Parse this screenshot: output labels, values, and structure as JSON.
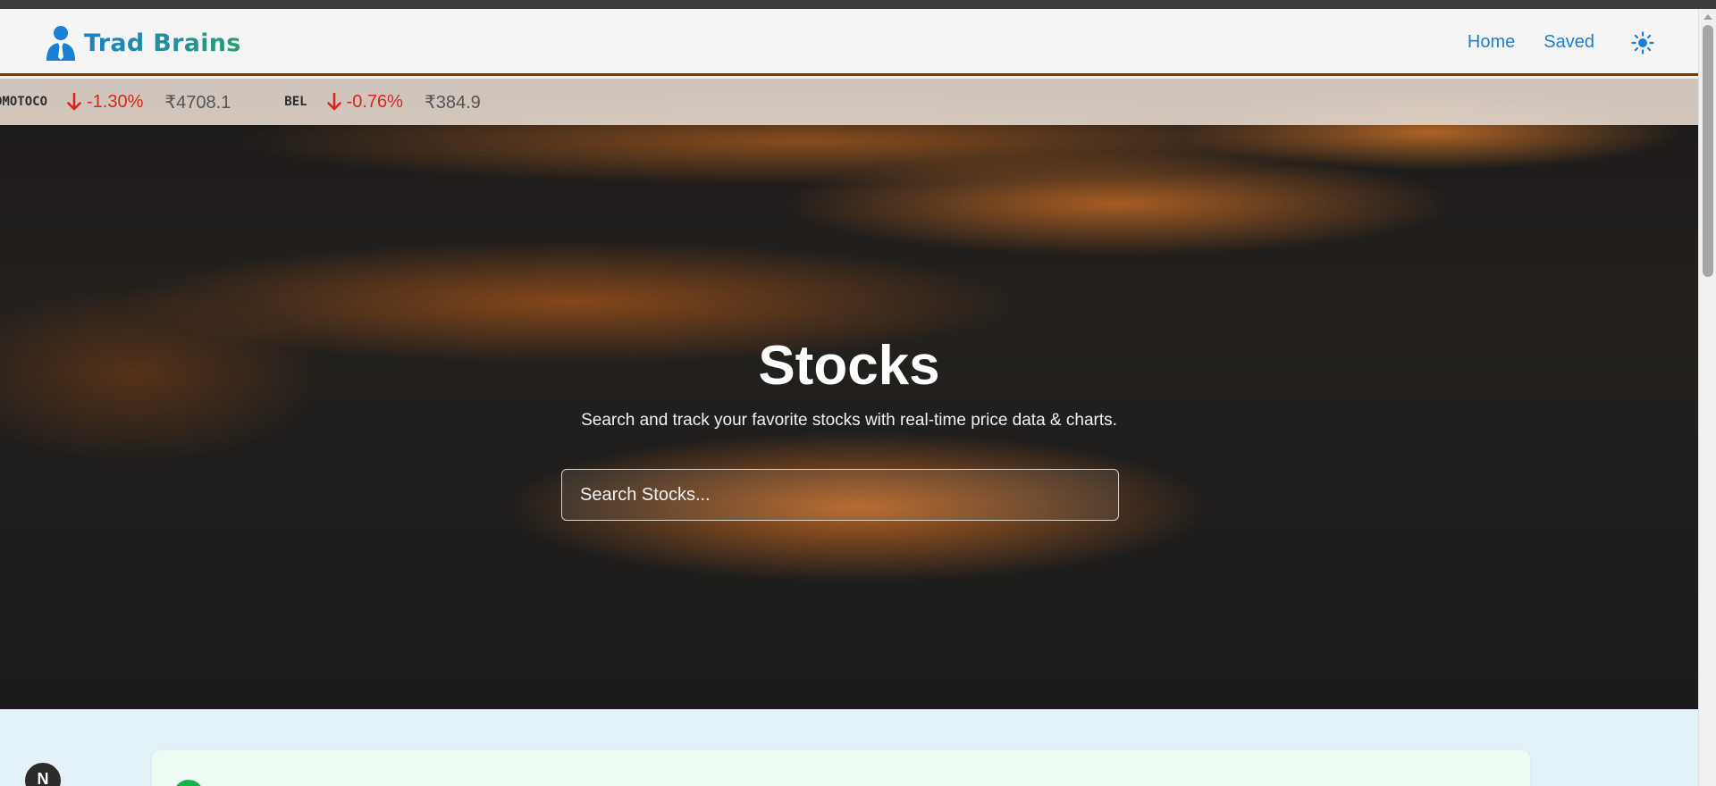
{
  "app": {
    "brand": "Trad Brains",
    "accent": "#1a7fd6",
    "brand_gradient": [
      "#1e7fc8",
      "#2a9c74"
    ]
  },
  "nav": {
    "home_label": "Home",
    "saved_label": "Saved",
    "theme_icon": "sun-icon"
  },
  "ticker": {
    "items": [
      {
        "symbol": "DMOTOCO",
        "change": "-1.30%",
        "price": "₹4708.1",
        "direction": "down"
      },
      {
        "symbol": "BEL",
        "change": "-0.76%",
        "price": "₹384.9",
        "direction": "down"
      }
    ],
    "down_color": "#d9261c"
  },
  "hero": {
    "title": "Stocks",
    "subtitle": "Search and track your favorite stocks with real-time price data & charts.",
    "search_placeholder": "Search Stocks..."
  },
  "fab": {
    "letter": "N"
  }
}
